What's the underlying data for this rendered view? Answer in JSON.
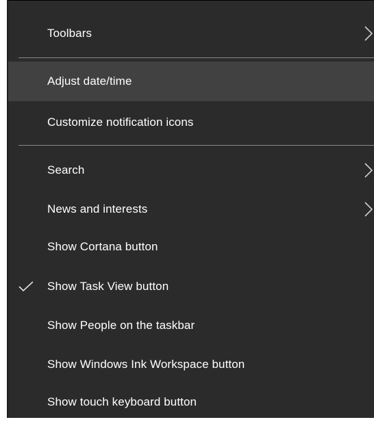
{
  "menu": {
    "items": [
      {
        "label": "Toolbars",
        "submenu": true,
        "checked": false,
        "highlighted": false
      },
      {
        "label": "Adjust date/time",
        "submenu": false,
        "checked": false,
        "highlighted": true
      },
      {
        "label": "Customize notification icons",
        "submenu": false,
        "checked": false,
        "highlighted": false
      },
      {
        "label": "Search",
        "submenu": true,
        "checked": false,
        "highlighted": false
      },
      {
        "label": "News and interests",
        "submenu": true,
        "checked": false,
        "highlighted": false
      },
      {
        "label": "Show Cortana button",
        "submenu": false,
        "checked": false,
        "highlighted": false
      },
      {
        "label": "Show Task View button",
        "submenu": false,
        "checked": true,
        "highlighted": false
      },
      {
        "label": "Show People on the taskbar",
        "submenu": false,
        "checked": false,
        "highlighted": false
      },
      {
        "label": "Show Windows Ink Workspace button",
        "submenu": false,
        "checked": false,
        "highlighted": false
      },
      {
        "label": "Show touch keyboard button",
        "submenu": false,
        "checked": false,
        "highlighted": false
      }
    ],
    "icons": {
      "submenu": "chevron-right-icon",
      "check": "checkmark-icon"
    },
    "colors": {
      "background": "#2b2b2b",
      "highlight": "#414141",
      "separator": "#8a8a8a",
      "text": "#ffffff"
    }
  }
}
